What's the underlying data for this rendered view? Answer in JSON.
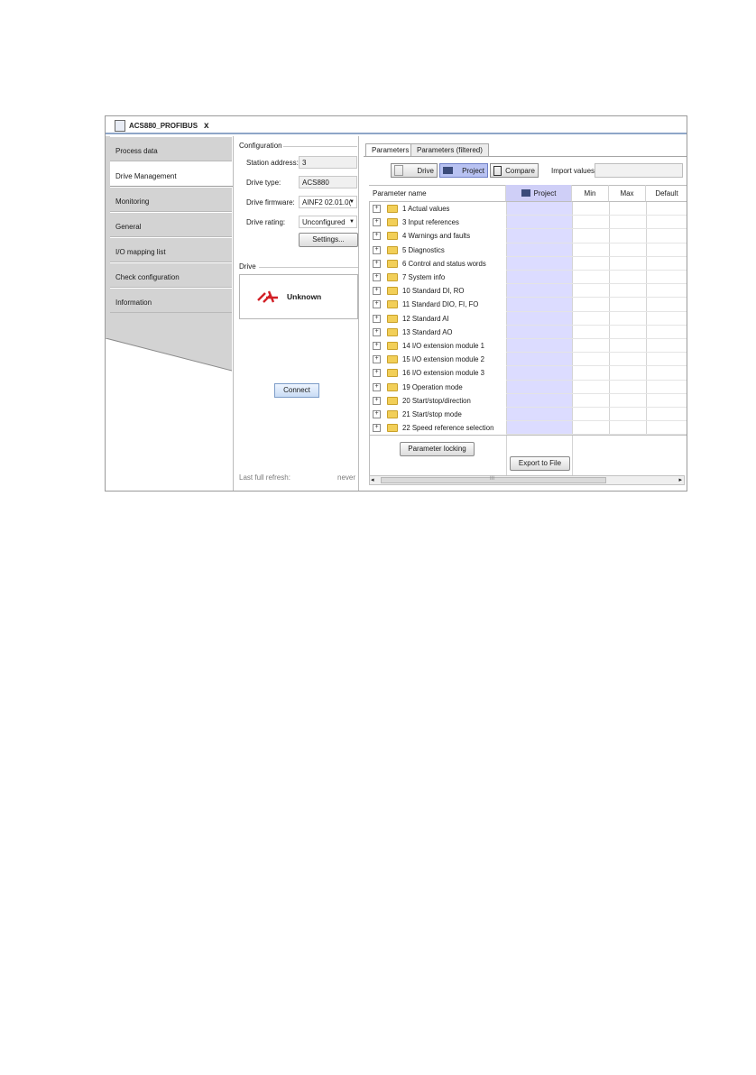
{
  "document_tab": {
    "title": "ACS880_PROFIBUS",
    "close": "x"
  },
  "nav": {
    "items": [
      {
        "label": "Process data",
        "active": false
      },
      {
        "label": "Drive Management",
        "active": true
      },
      {
        "label": "Monitoring",
        "active": false
      },
      {
        "label": "General",
        "active": false
      },
      {
        "label": "I/O mapping list",
        "active": false
      },
      {
        "label": "Check configuration",
        "active": false
      },
      {
        "label": "Information",
        "active": false
      }
    ]
  },
  "configuration": {
    "title": "Configuration",
    "station_address_label": "Station address:",
    "station_address_value": "3",
    "drive_type_label": "Drive type:",
    "drive_type_value": "ACS880",
    "drive_firmware_label": "Drive firmware:",
    "drive_firmware_value": "AINF2 02.01.0(",
    "drive_rating_label": "Drive rating:",
    "drive_rating_value": "Unconfigured",
    "settings_button": "Settings..."
  },
  "drive": {
    "title": "Drive",
    "status": "Unknown",
    "connect_button": "Connect",
    "last_refresh_label": "Last full refresh:",
    "last_refresh_value": "never"
  },
  "parameters": {
    "tabs": [
      "Parameters",
      "Parameters (filtered)"
    ],
    "toolbar": {
      "drive": "Drive",
      "project": "Project",
      "compare": "Compare",
      "import_label": "Import values:"
    },
    "columns": {
      "name": "Parameter name",
      "project": "Project",
      "min": "Min",
      "max": "Max",
      "default": "Default"
    },
    "rows": [
      "1 Actual values",
      "3 Input references",
      "4 Warnings and faults",
      "5 Diagnostics",
      "6 Control and status words",
      "7 System info",
      "10 Standard DI, RO",
      "11 Standard DIO, FI, FO",
      "12 Standard AI",
      "13 Standard AO",
      "14 I/O extension module 1",
      "15 I/O extension module 2",
      "16 I/O extension module 3",
      "19 Operation mode",
      "20 Start/stop/direction",
      "21 Start/stop mode",
      "22 Speed reference selection"
    ],
    "parameter_locking_button": "Parameter locking",
    "export_button": "Export to File",
    "scroll_left": "◂",
    "scroll_right": "▸",
    "scroll_grip": "III",
    "expand_glyph": "+"
  }
}
